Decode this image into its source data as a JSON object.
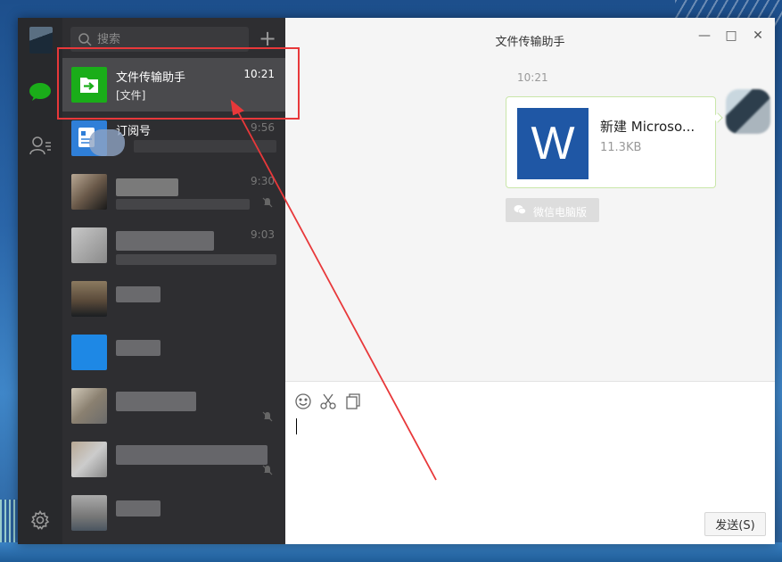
{
  "window": {
    "chat_title": "文件传输助手",
    "minimize": "—",
    "maximize": "□",
    "close": "✕"
  },
  "search": {
    "placeholder": "搜索"
  },
  "add_label": "+",
  "conversations": [
    {
      "name": "文件传输助手",
      "time": "10:21",
      "preview": "[文件]",
      "active": true
    },
    {
      "name": "订阅号",
      "time": "9:56"
    },
    {
      "time": "9:30"
    },
    {
      "time": "9:03"
    }
  ],
  "message": {
    "time": "10:21",
    "file_name": "新建 Microso...",
    "file_size": "11.3KB",
    "file_icon_letter": "W",
    "source_tag": "微信电脑版"
  },
  "compose": {
    "send_label": "发送(S)"
  },
  "colors": {
    "accent_green": "#1aad19",
    "highlight_red": "#e8383a",
    "word_blue": "#1f57a5",
    "rail_bg": "#28292c",
    "list_bg": "#2e2e31"
  }
}
